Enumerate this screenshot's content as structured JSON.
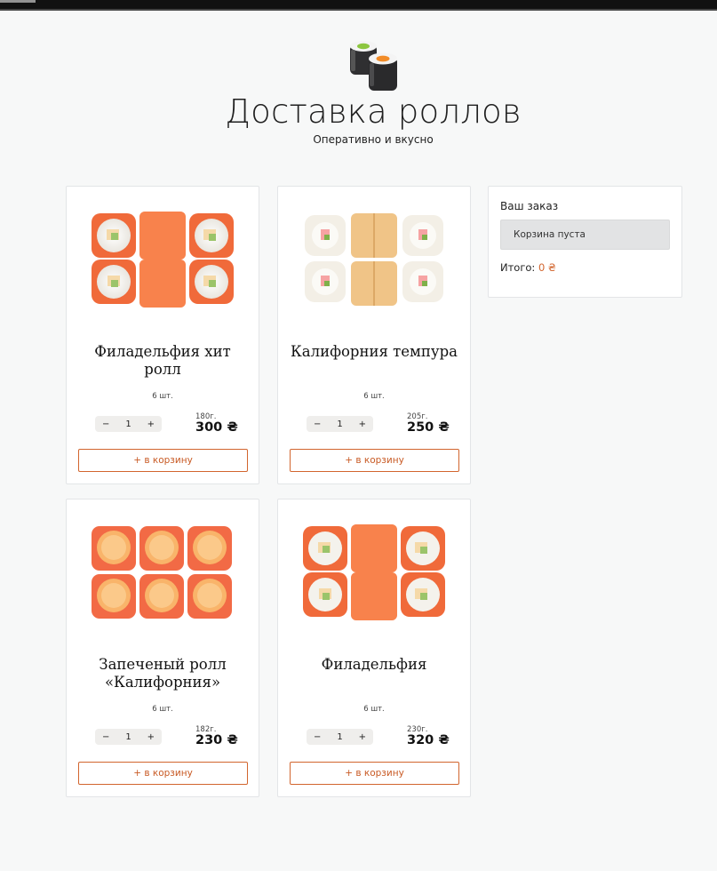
{
  "header": {
    "title": "Доставка роллов",
    "subtitle": "Оперативно и вкусно"
  },
  "colors": {
    "accent": "#d2652e",
    "page_bg": "#f7f8f8",
    "card_bg": "#ffffff"
  },
  "products": [
    {
      "name": "Филадельфия хит ролл",
      "pieces": "6 шт.",
      "qty": "1",
      "minus": "−",
      "plus": "+",
      "weight": "180г.",
      "price": "300 ₴",
      "button": "+ в корзину",
      "image": "philadelphia-hit-roll"
    },
    {
      "name": "Калифорния темпура",
      "pieces": "6 шт.",
      "qty": "1",
      "minus": "−",
      "plus": "+",
      "weight": "205г.",
      "price": "250 ₴",
      "button": "+ в корзину",
      "image": "california-tempura"
    },
    {
      "name": "Запеченый ролл «Калифорния»",
      "pieces": "6 шт.",
      "qty": "1",
      "minus": "−",
      "plus": "+",
      "weight": "182г.",
      "price": "230 ₴",
      "button": "+ в корзину",
      "image": "baked-california"
    },
    {
      "name": "Филадельфия",
      "pieces": "6 шт.",
      "qty": "1",
      "minus": "−",
      "plus": "+",
      "weight": "230г.",
      "price": "320 ₴",
      "button": "+ в корзину",
      "image": "philadelphia"
    }
  ],
  "order": {
    "heading": "Ваш заказ",
    "empty": "Корзина пуста",
    "total_label": "Итого:",
    "total_value": "0 ₴"
  }
}
